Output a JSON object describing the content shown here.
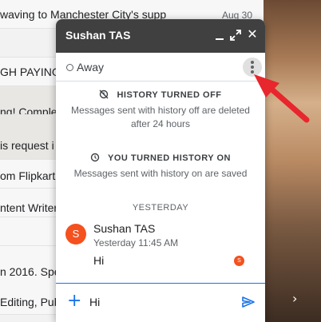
{
  "background_list": {
    "rows": [
      {
        "text": "waving to Manchester City's supp",
        "date": "Aug 30"
      },
      {
        "text": "",
        "date": ""
      },
      {
        "text": "GH PAYING",
        "date": ""
      },
      {
        "text": "ng! Complet",
        "date": ""
      },
      {
        "text": "is request i",
        "date": ""
      },
      {
        "text": "om Flipkart",
        "date": ""
      },
      {
        "text": "ntent Writer",
        "date": ""
      },
      {
        "text": "",
        "date": ""
      },
      {
        "text": "",
        "date": ""
      },
      {
        "text": "n 2016. Spe",
        "date": ""
      },
      {
        "text": "Editing, Pub",
        "date": ""
      }
    ]
  },
  "chat": {
    "title": "Sushan TAS",
    "status": "Away",
    "notices": [
      {
        "title": "HISTORY TURNED OFF",
        "body": "Messages sent with history off are deleted after 24 hours",
        "icon": "history-off-icon"
      },
      {
        "title": "YOU TURNED HISTORY ON",
        "body": "Messages sent with history on are saved",
        "icon": "history-on-icon"
      }
    ],
    "divider": "YESTERDAY",
    "message": {
      "avatar_letter": "S",
      "sender": "Sushan TAS",
      "time": "Yesterday 11:45 AM",
      "text": "Hi",
      "read_receipt_letter": "S"
    },
    "compose": {
      "value": "Hi"
    }
  },
  "colors": {
    "header": "#404040",
    "accent": "#1a73e8",
    "avatar": "#f4511e",
    "annotation_arrow": "#e8262d"
  }
}
